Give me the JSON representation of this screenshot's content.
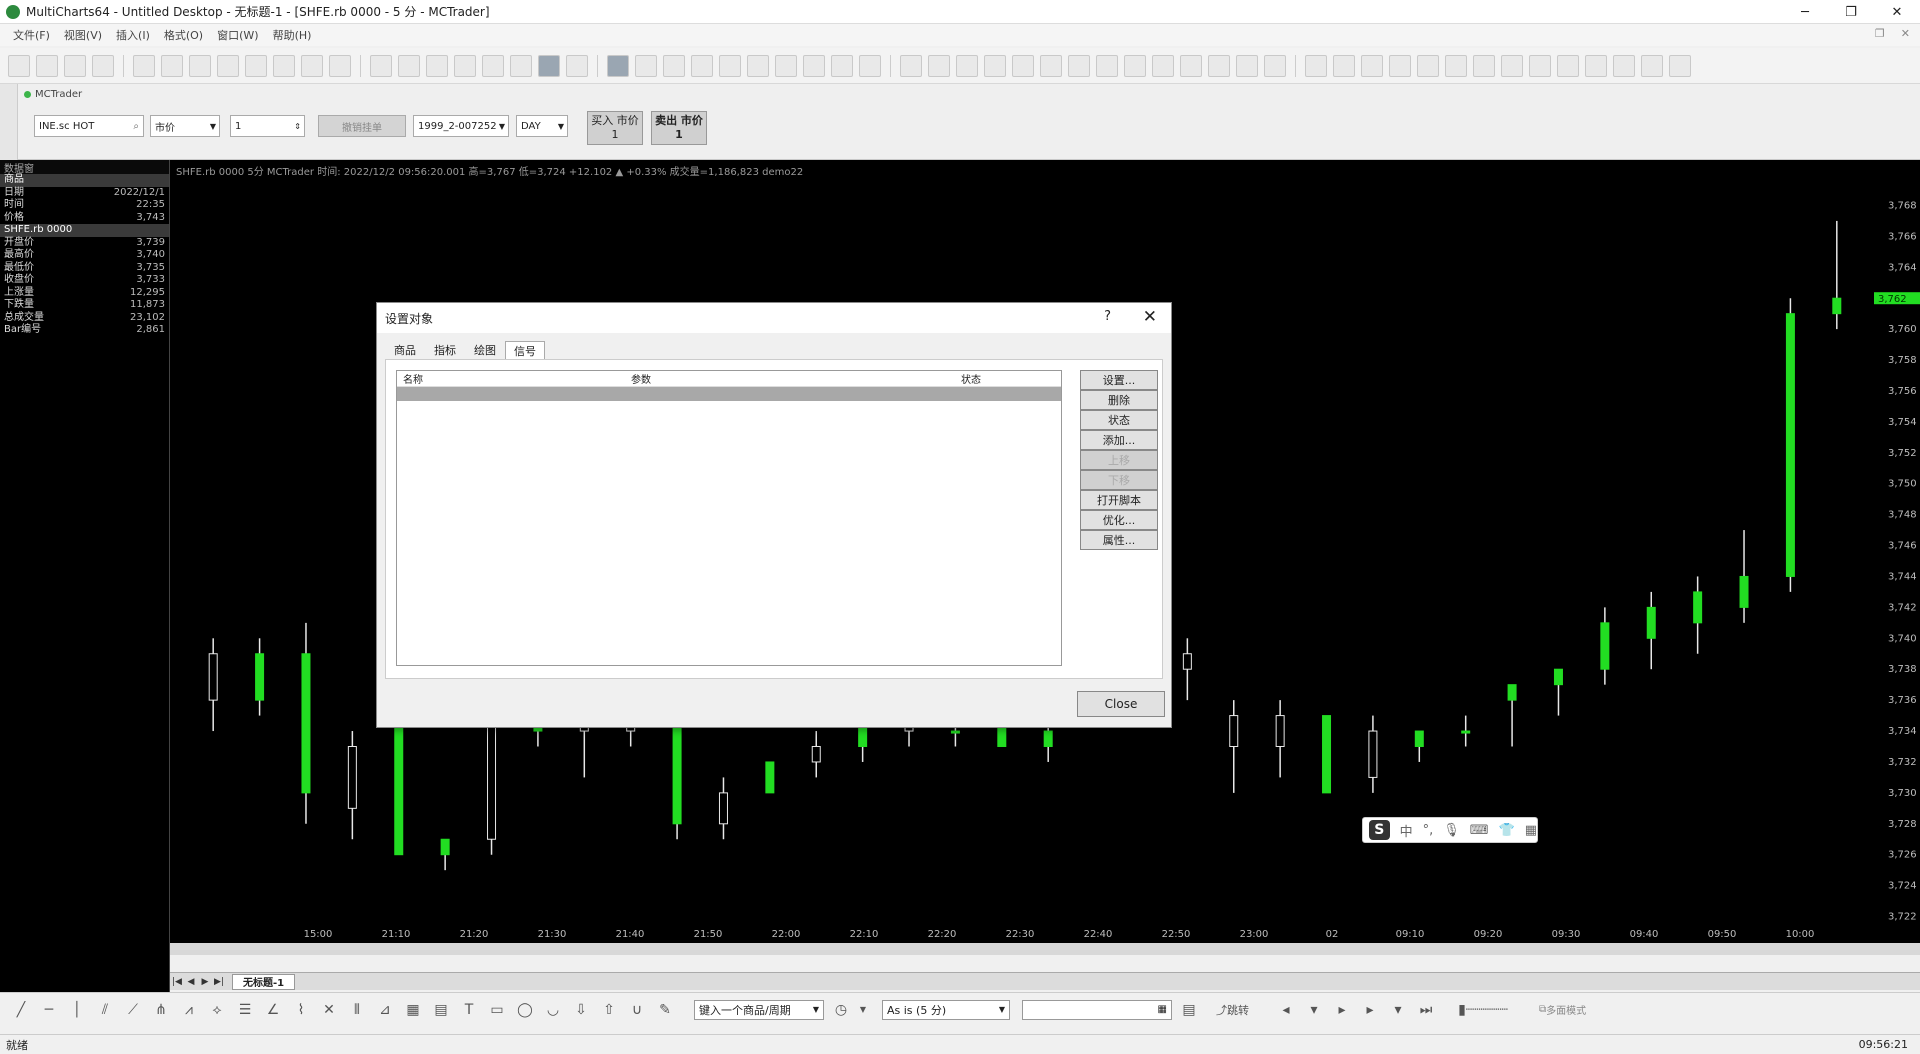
{
  "window": {
    "title": "MultiCharts64 - Untitled Desktop - 无标题-1 - [SHFE.rb 0000 - 5 分 - MCTrader]"
  },
  "menu": [
    "文件(F)",
    "视图(V)",
    "插入(I)",
    "格式(O)",
    "窗口(W)",
    "帮助(H)"
  ],
  "trader": {
    "tab_label": "MCTrader",
    "symbol": "INE.sc HOT",
    "order_type": "市价",
    "quantity": "1",
    "account_btn": "撤销挂单",
    "account": "1999_2-007252",
    "tif": "DAY",
    "buy": {
      "label": "买入 市价",
      "qty": "1"
    },
    "sell": {
      "label": "卖出 市价",
      "qty": "1"
    }
  },
  "datawindow": {
    "header": "数据窗",
    "rows": [
      {
        "k": "商品",
        "v": "",
        "sel": true
      },
      {
        "k": "日期",
        "v": "2022/12/1"
      },
      {
        "k": "时间",
        "v": "22:35"
      },
      {
        "k": "价格",
        "v": "3,743"
      },
      {
        "k": "SHFE.rb 0000",
        "v": "",
        "sel": true
      },
      {
        "k": "开盘价",
        "v": "3,739"
      },
      {
        "k": "最高价",
        "v": "3,740"
      },
      {
        "k": "最低价",
        "v": "3,735"
      },
      {
        "k": "收盘价",
        "v": "3,733"
      },
      {
        "k": "上涨量",
        "v": "12,295"
      },
      {
        "k": "下跌量",
        "v": "11,873"
      },
      {
        "k": "总成交量",
        "v": "23,102"
      },
      {
        "k": "Bar编号",
        "v": "2,861"
      }
    ]
  },
  "chart": {
    "status_line": "SHFE.rb 0000  5分  MCTrader  时间: 2022/12/2  09:56:20.001  高=3,767  低=3,724  +12.102  ▲  +0.33%  成交量=1,186,823  demo22",
    "current_price": "3,762",
    "price_ticks": [
      "3,768",
      "3,766",
      "3,764",
      "3,762",
      "3,760",
      "3,758",
      "3,756",
      "3,754",
      "3,752",
      "3,750",
      "3,748",
      "3,746",
      "3,744",
      "3,742",
      "3,740",
      "3,738",
      "3,736",
      "3,734",
      "3,732",
      "3,730",
      "3,728",
      "3,726",
      "3,724",
      "3,722"
    ],
    "time_ticks": [
      "15:00",
      "21:10",
      "21:20",
      "21:30",
      "21:40",
      "21:50",
      "22:00",
      "22:10",
      "22:20",
      "22:30",
      "22:40",
      "22:50",
      "23:00",
      "02",
      "09:10",
      "09:20",
      "09:30",
      "09:40",
      "09:50",
      "10:00"
    ],
    "up_color": "#22dd22",
    "down_color": "#000000",
    "wick_color": "#e8e8e8"
  },
  "chart_data": {
    "type": "candlestick",
    "ylim": [
      3721,
      3769
    ],
    "candles": [
      {
        "o": 3739,
        "h": 3740,
        "l": 3734,
        "c": 3736
      },
      {
        "o": 3736,
        "h": 3740,
        "l": 3735,
        "c": 3739
      },
      {
        "o": 3730,
        "h": 3741,
        "l": 3728,
        "c": 3739
      },
      {
        "o": 3733,
        "h": 3734,
        "l": 3727,
        "c": 3729
      },
      {
        "o": 3726,
        "h": 3738,
        "l": 3726,
        "c": 3737
      },
      {
        "o": 3726,
        "h": 3727,
        "l": 3725,
        "c": 3727
      },
      {
        "o": 3736,
        "h": 3739,
        "l": 3726,
        "c": 3727
      },
      {
        "o": 3734,
        "h": 3736,
        "l": 3733,
        "c": 3735
      },
      {
        "o": 3735,
        "h": 3736,
        "l": 3731,
        "c": 3734
      },
      {
        "o": 3735,
        "h": 3736,
        "l": 3733,
        "c": 3734
      },
      {
        "o": 3728,
        "h": 3736,
        "l": 3727,
        "c": 3735
      },
      {
        "o": 3730,
        "h": 3731,
        "l": 3727,
        "c": 3728
      },
      {
        "o": 3730,
        "h": 3732,
        "l": 3730,
        "c": 3732
      },
      {
        "o": 3733,
        "h": 3734,
        "l": 3731,
        "c": 3732
      },
      {
        "o": 3733,
        "h": 3735,
        "l": 3732,
        "c": 3735
      },
      {
        "o": 3735,
        "h": 3735,
        "l": 3733,
        "c": 3734
      },
      {
        "o": 3734,
        "h": 3735,
        "l": 3733,
        "c": 3734
      },
      {
        "o": 3733,
        "h": 3735,
        "l": 3733,
        "c": 3735
      },
      {
        "o": 3733,
        "h": 3735,
        "l": 3732,
        "c": 3734
      },
      {
        "o": 3740,
        "h": 3741,
        "l": 3735,
        "c": 3737
      },
      {
        "o": 3738,
        "h": 3745,
        "l": 3736,
        "c": 3740
      },
      {
        "o": 3739,
        "h": 3740,
        "l": 3736,
        "c": 3738
      },
      {
        "o": 3735,
        "h": 3736,
        "l": 3730,
        "c": 3733
      },
      {
        "o": 3735,
        "h": 3736,
        "l": 3731,
        "c": 3733
      },
      {
        "o": 3730,
        "h": 3735,
        "l": 3730,
        "c": 3735
      },
      {
        "o": 3734,
        "h": 3735,
        "l": 3730,
        "c": 3731
      },
      {
        "o": 3733,
        "h": 3734,
        "l": 3732,
        "c": 3734
      },
      {
        "o": 3734,
        "h": 3735,
        "l": 3733,
        "c": 3734
      },
      {
        "o": 3736,
        "h": 3737,
        "l": 3733,
        "c": 3737
      },
      {
        "o": 3737,
        "h": 3738,
        "l": 3735,
        "c": 3738
      },
      {
        "o": 3738,
        "h": 3742,
        "l": 3737,
        "c": 3741
      },
      {
        "o": 3740,
        "h": 3743,
        "l": 3738,
        "c": 3742
      },
      {
        "o": 3741,
        "h": 3744,
        "l": 3739,
        "c": 3743
      },
      {
        "o": 3742,
        "h": 3747,
        "l": 3741,
        "c": 3744
      },
      {
        "o": 3744,
        "h": 3762,
        "l": 3743,
        "c": 3761
      },
      {
        "o": 3761,
        "h": 3767,
        "l": 3760,
        "c": 3762
      }
    ]
  },
  "dialog": {
    "title": "设置对象",
    "help": "?",
    "tabs": [
      "商品",
      "指标",
      "绘图",
      "信号"
    ],
    "active_tab": 3,
    "columns": {
      "name": "名称",
      "params": "参数",
      "status": "状态"
    },
    "rows": [
      {
        "name": "",
        "params": "",
        "status": ""
      }
    ],
    "buttons": [
      "设置...",
      "删除",
      "状态",
      "添加...",
      "上移",
      "下移",
      "打开脚本",
      "优化...",
      "属性..."
    ],
    "disabled": [
      4,
      5
    ],
    "close": "Close"
  },
  "workspace": {
    "tab": "无标题-1"
  },
  "bottombar": {
    "symbol_input": "键入一个商品/周期",
    "mode": "As is (5 分)",
    "jump": "跳转",
    "overlay_label": "多面模式"
  },
  "ime": {
    "logo": "S",
    "lang": "中"
  },
  "status": {
    "left": "就绪",
    "clock": "09:56:21"
  }
}
